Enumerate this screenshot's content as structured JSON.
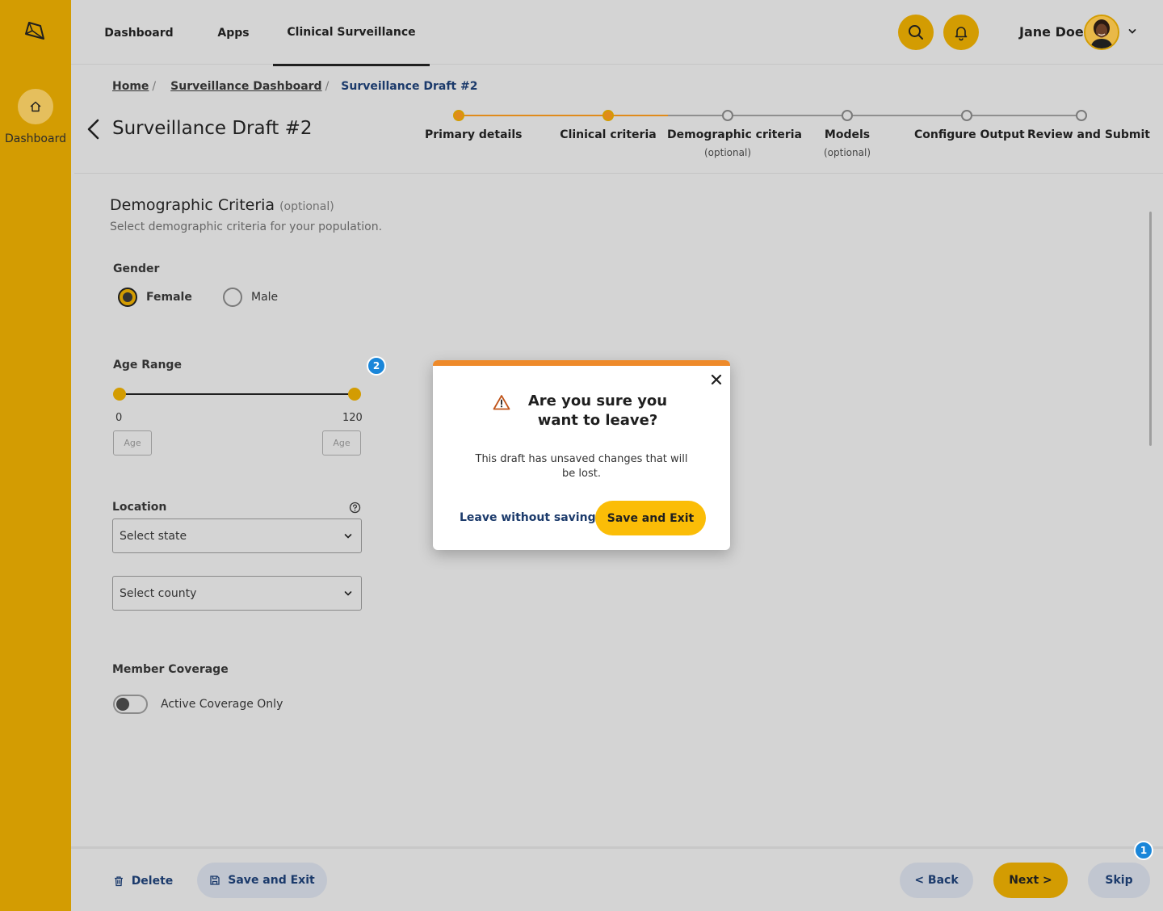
{
  "sidebar": {
    "nav_label": "Dashboard"
  },
  "topnav": {
    "tabs": [
      {
        "label": "Dashboard"
      },
      {
        "label": "Apps"
      },
      {
        "label": "Clinical Surveillance"
      }
    ],
    "active_tab": "Clinical Surveillance",
    "user_name": "Jane Doe"
  },
  "breadcrumb": {
    "items": [
      "Home",
      "Surveillance Dashboard"
    ],
    "current": "Surveillance Draft #2"
  },
  "page": {
    "title": "Surveillance Draft #2"
  },
  "stepper": {
    "steps": [
      {
        "label": "Primary details",
        "sub": "",
        "status": "complete"
      },
      {
        "label": "Clinical criteria",
        "sub": "",
        "status": "current"
      },
      {
        "label": "Demographic criteria",
        "sub": "(optional)",
        "status": "upcoming"
      },
      {
        "label": "Models",
        "sub": "(optional)",
        "status": "upcoming"
      },
      {
        "label": "Configure Output",
        "sub": "",
        "status": "upcoming"
      },
      {
        "label": "Review and Submit",
        "sub": "",
        "status": "upcoming"
      }
    ]
  },
  "form": {
    "title": "Demographic Criteria",
    "title_optional": "(optional)",
    "description": "Select demographic criteria for your population.",
    "gender": {
      "label": "Gender",
      "options": [
        "Female",
        "Male"
      ],
      "selected": "Female"
    },
    "age_range": {
      "label": "Age Range",
      "badge": "2",
      "min": "0",
      "max": "120",
      "min_placeholder": "Age",
      "max_placeholder": "Age"
    },
    "location": {
      "label": "Location",
      "state_value": "Select state",
      "county_value": "Select county"
    },
    "coverage": {
      "label": "Member Coverage",
      "toggle_label": "Active Coverage Only",
      "enabled": false
    }
  },
  "footer": {
    "delete_label": "Delete",
    "save_exit_label": "Save and Exit",
    "back_label": "< Back",
    "next_label": "Next >",
    "skip_label": "Skip",
    "skip_badge": "1"
  },
  "modal": {
    "title": "Are you sure you want to leave?",
    "body": "This draft has unsaved changes that will be lost.",
    "leave_label": "Leave without saving",
    "save_label": "Save and Exit"
  },
  "colors": {
    "brand": "#d39c02",
    "progress": "#e08b1b",
    "modal_accent": "#ee8a2a",
    "primary_button": "#fbbd07",
    "link": "#1b3a6b",
    "badge": "#1a86d9"
  }
}
